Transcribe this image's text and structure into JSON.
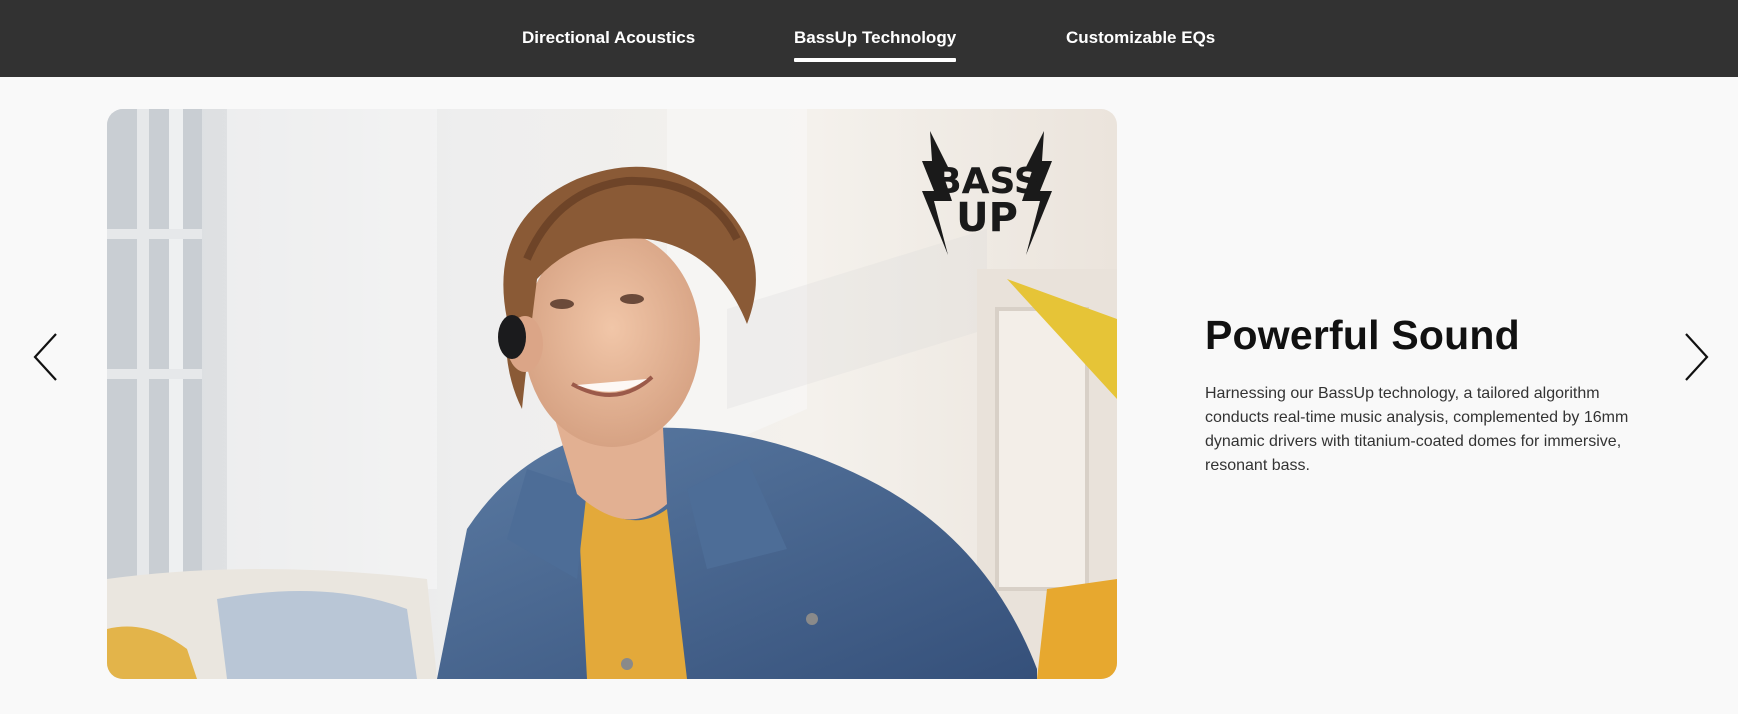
{
  "nav": {
    "tabs": [
      {
        "label": "Directional Acoustics",
        "active": false
      },
      {
        "label": "BassUp Technology",
        "active": true
      },
      {
        "label": "Customizable EQs",
        "active": false
      }
    ]
  },
  "carousel": {
    "prev_icon": "chevron-left-icon",
    "next_icon": "chevron-right-icon"
  },
  "slide": {
    "logo_text_top": "BASS",
    "logo_text_bottom": "UP",
    "title": "Powerful Sound",
    "description": "Harnessing our BassUp technology, a tailored algorithm conducts real-time music analysis, complemented by 16mm dynamic drivers with titanium-coated domes for immersive, resonant bass."
  },
  "colors": {
    "nav_bg": "#323232",
    "page_bg": "#f9f9f9",
    "jacket": "#4a6a93",
    "shirt": "#e0a93a"
  }
}
